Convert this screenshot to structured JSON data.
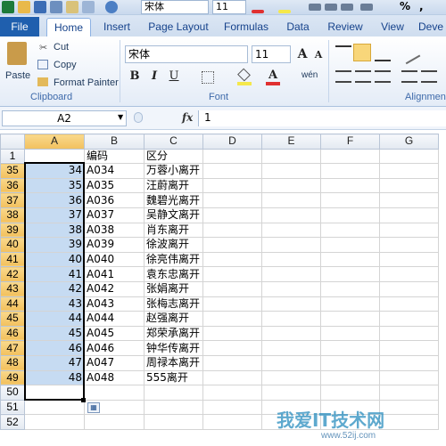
{
  "qat": {
    "font_name": "宋体",
    "font_size": "11",
    "percent_glyph": "%"
  },
  "tabs": [
    "File",
    "Home",
    "Insert",
    "Page Layout",
    "Formulas",
    "Data",
    "Review",
    "View",
    "Deve"
  ],
  "ribbon": {
    "paste_label": "Paste",
    "cut_label": "Cut",
    "copy_label": "Copy",
    "format_painter_label": "Format Painter",
    "clipboard_group": "Clipboard",
    "font_name": "宋体",
    "font_size": "11",
    "font_group": "Font",
    "alignment_group": "Alignmen",
    "bold": "B",
    "italic": "I",
    "underline": "U",
    "grow_font": "A",
    "shrink_font": "A",
    "phonetic": "wén",
    "font_color": "#e03030",
    "fill_color": "#f5e84b"
  },
  "formula_bar": {
    "name_box": "A2",
    "fx": "fx",
    "content": "1"
  },
  "columns": [
    "A",
    "B",
    "C",
    "D",
    "E",
    "F",
    "G"
  ],
  "rows": [
    {
      "row": "1",
      "a": "",
      "b": "编码",
      "c": "区分"
    },
    {
      "row": "35",
      "a": "34",
      "b": "A034",
      "c": "万蓉小离开"
    },
    {
      "row": "36",
      "a": "35",
      "b": "A035",
      "c": "汪蔚离开"
    },
    {
      "row": "37",
      "a": "36",
      "b": "A036",
      "c": "魏碧光离开"
    },
    {
      "row": "38",
      "a": "37",
      "b": "A037",
      "c": "吴静文离开"
    },
    {
      "row": "39",
      "a": "38",
      "b": "A038",
      "c": "肖东离开"
    },
    {
      "row": "40",
      "a": "39",
      "b": "A039",
      "c": "徐波离开"
    },
    {
      "row": "41",
      "a": "40",
      "b": "A040",
      "c": "徐亮伟离开"
    },
    {
      "row": "42",
      "a": "41",
      "b": "A041",
      "c": "袁东忠离开"
    },
    {
      "row": "43",
      "a": "42",
      "b": "A042",
      "c": "张娟离开"
    },
    {
      "row": "44",
      "a": "43",
      "b": "A043",
      "c": "张梅志离开"
    },
    {
      "row": "45",
      "a": "44",
      "b": "A044",
      "c": "赵强离开"
    },
    {
      "row": "46",
      "a": "45",
      "b": "A045",
      "c": "郑荣承离开"
    },
    {
      "row": "47",
      "a": "46",
      "b": "A046",
      "c": "钟华传离开"
    },
    {
      "row": "48",
      "a": "47",
      "b": "A047",
      "c": "周禄本离开"
    },
    {
      "row": "49",
      "a": "48",
      "b": "A048",
      "c": "555离开"
    },
    {
      "row": "50",
      "a": "",
      "b": "",
      "c": ""
    },
    {
      "row": "51",
      "a": "",
      "b": "",
      "c": ""
    },
    {
      "row": "52",
      "a": "",
      "b": "",
      "c": ""
    }
  ],
  "selection_color": "#c6dbf2",
  "watermark": {
    "text": "我爱IT技术网",
    "url": "www.52ij.com"
  }
}
